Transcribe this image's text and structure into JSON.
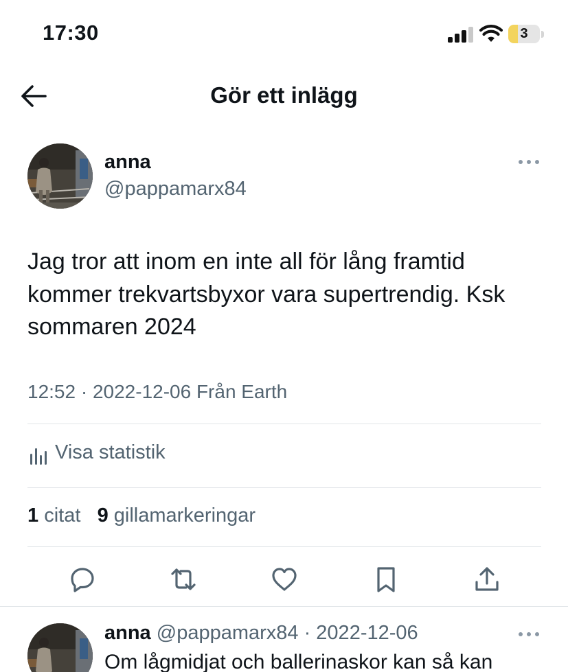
{
  "status_bar": {
    "time": "17:30",
    "battery_level": "3",
    "icons": [
      "cellular-signal-icon",
      "wifi-icon",
      "battery-icon"
    ]
  },
  "header": {
    "title": "Gör ett inlägg",
    "back_icon": "arrow-left-icon"
  },
  "post": {
    "author_name": "anna",
    "author_handle": "@pappamarx84",
    "text": "Jag tror att inom en inte all för lång framtid kommer trekvartsbyxor vara supertrendig. Ksk sommaren 2024",
    "meta": "12:52 · 2022-12-06 Från Earth",
    "stats_label": "Visa statistik",
    "quotes_count": "1",
    "quotes_label": "citat",
    "likes_count": "9",
    "likes_label": "gillamarkeringar",
    "actions": [
      "reply-icon",
      "retweet-icon",
      "like-icon",
      "bookmark-icon",
      "share-icon"
    ]
  },
  "reply": {
    "author_name": "anna",
    "meta": "@pappamarx84 · 2022-12-06",
    "text": "Om lågmidjat och ballerinaskor kan så kan"
  },
  "colors": {
    "text_primary": "#0f1419",
    "text_secondary": "#536471",
    "divider": "#e1e5e8",
    "battery_fill": "#f3d45e"
  }
}
